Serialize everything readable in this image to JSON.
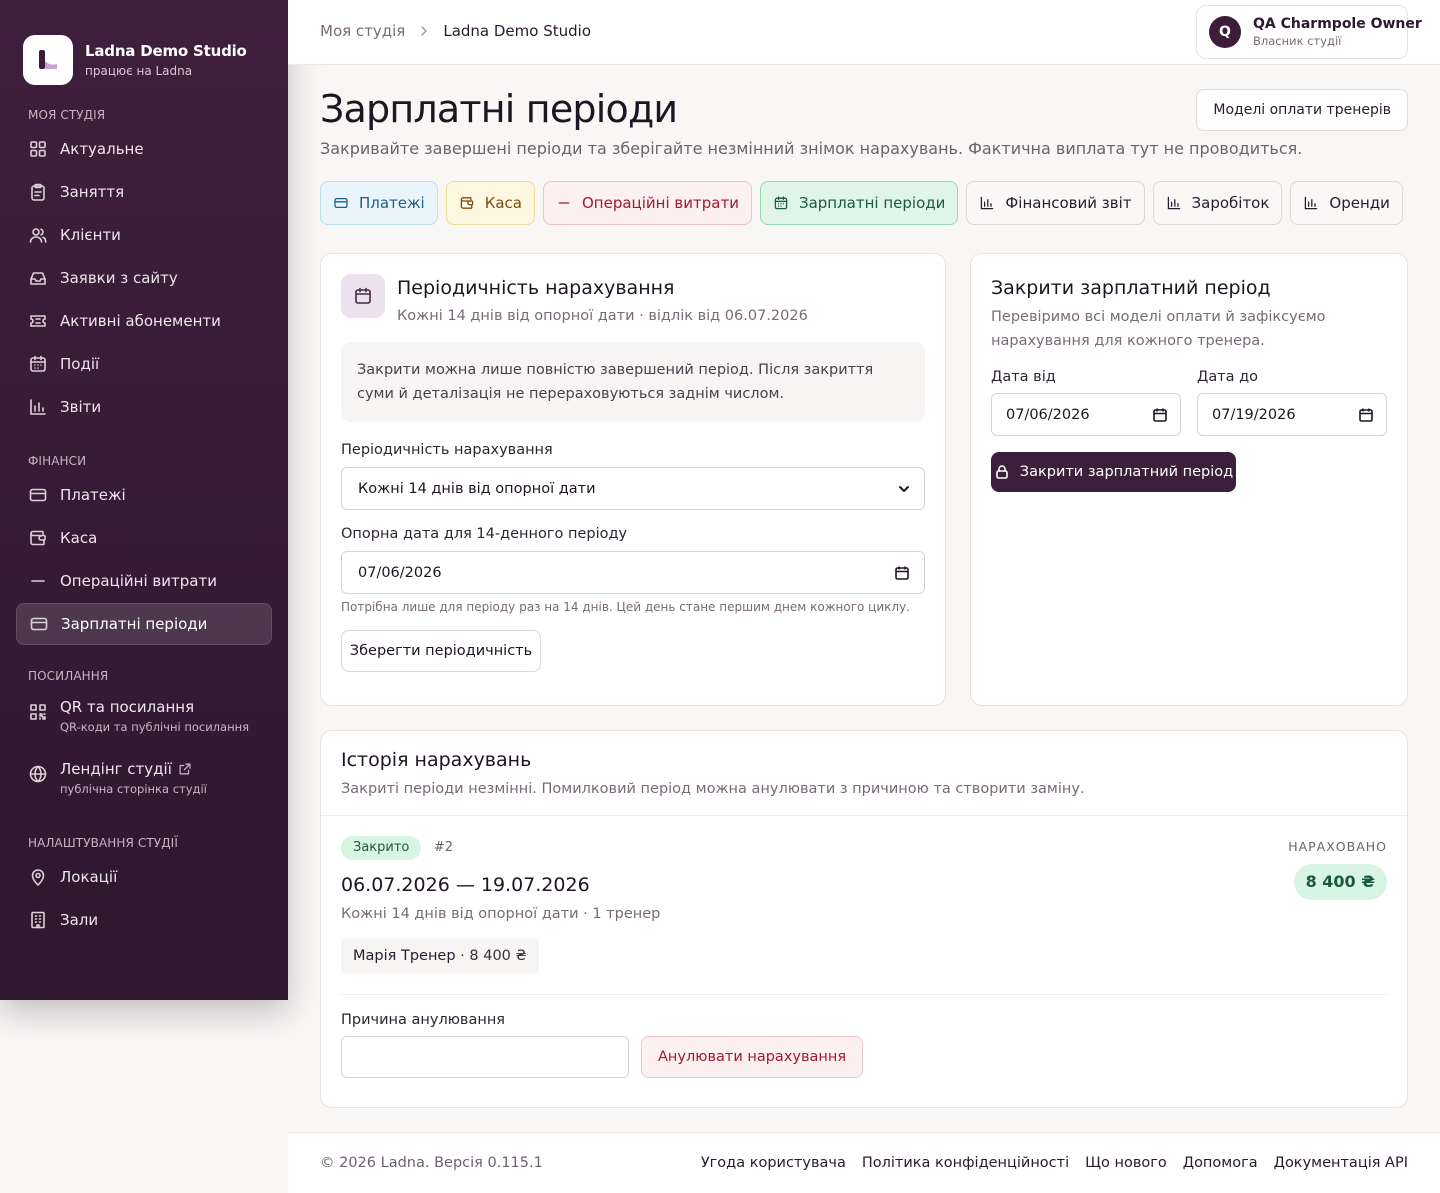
{
  "brand": {
    "name": "Ladna Demo Studio",
    "sub": "працює на Ladna"
  },
  "sidebar": {
    "sections": [
      {
        "label": "МОЯ СТУДІЯ",
        "items": [
          {
            "label": "Актуальне",
            "icon": "dashboard-icon"
          },
          {
            "label": "Заняття",
            "icon": "clipboard-icon"
          },
          {
            "label": "Клієнти",
            "icon": "users-icon"
          },
          {
            "label": "Заявки з сайту",
            "icon": "inbox-icon"
          },
          {
            "label": "Активні абонементи",
            "icon": "ticket-icon"
          },
          {
            "label": "Події",
            "icon": "calendar-icon"
          },
          {
            "label": "Звіти",
            "icon": "bar-chart-icon"
          }
        ]
      },
      {
        "label": "ФІНАНСИ",
        "items": [
          {
            "label": "Платежі",
            "icon": "card-icon"
          },
          {
            "label": "Каса",
            "icon": "wallet-icon"
          },
          {
            "label": "Операційні витрати",
            "icon": "minus-icon"
          },
          {
            "label": "Зарплатні періоди",
            "icon": "card-icon",
            "active": true
          }
        ]
      },
      {
        "label": "ПОСИЛАННЯ",
        "items": [
          {
            "label": "QR та посилання",
            "sub": "QR-коди та публічні посилання",
            "icon": "qr-icon"
          },
          {
            "label": "Лендінг студії",
            "sub": "публічна сторінка студії",
            "icon": "globe-icon",
            "external": true
          }
        ]
      },
      {
        "label": "НАЛАШТУВАННЯ СТУДІЇ",
        "items": [
          {
            "label": "Локації",
            "icon": "map-pin-icon"
          },
          {
            "label": "Зали",
            "icon": "building-icon"
          }
        ]
      }
    ]
  },
  "header": {
    "breadcrumb": [
      "Моя студія",
      "Ladna Demo Studio"
    ],
    "user": {
      "initial": "Q",
      "name": "QA Charmpole Owner",
      "role": "Власник студії"
    }
  },
  "page": {
    "title": "Зарплатні періоди",
    "subtitle": "Закривайте завершені періоди та зберігайте незмінний знімок нарахувань. Фактична виплата тут не проводиться.",
    "models_button": "Моделі оплати тренерів",
    "tabs": [
      {
        "label": "Платежі",
        "icon": "card-icon",
        "style": "blue"
      },
      {
        "label": "Каса",
        "icon": "wallet-icon",
        "style": "yellow"
      },
      {
        "label": "Операційні витрати",
        "icon": "minus-icon",
        "style": "red"
      },
      {
        "label": "Зарплатні періоди",
        "icon": "calendar-icon",
        "style": "green"
      },
      {
        "label": "Фінансовий звіт",
        "icon": "bar-chart-icon",
        "style": "plain"
      },
      {
        "label": "Заробіток",
        "icon": "bar-chart-icon",
        "style": "plain"
      },
      {
        "label": "Оренди",
        "icon": "bar-chart-icon",
        "style": "plain"
      }
    ]
  },
  "periodicity": {
    "title": "Періодичність нарахування",
    "subtitle": "Кожні 14 днів від опорної дати · відлік від 06.07.2026",
    "note": "Закрити можна лише повністю завершений період. Після закриття суми й деталізація не перераховуються заднім числом.",
    "select_label": "Періодичність нарахування",
    "select_value": "Кожні 14 днів від опорної дати",
    "date_label": "Опорна дата для 14-денного періоду",
    "date_value": "07/06/2026",
    "hint": "Потрібна лише для періоду раз на 14 днів. Цей день стане першим днем кожного циклу.",
    "save_button": "Зберегти періодичність"
  },
  "close_period": {
    "title": "Закрити зарплатний період",
    "subtitle": "Перевіримо всі моделі оплати й зафіксуємо нарахування для кожного тренера.",
    "from_label": "Дата від",
    "from_value": "07/06/2026",
    "to_label": "Дата до",
    "to_value": "07/19/2026",
    "button": "Закрити зарплатний період"
  },
  "history": {
    "title": "Історія нарахувань",
    "subtitle": "Закриті періоди незмінні. Помилковий період можна анулювати з причиною та створити заміну.",
    "entry": {
      "status": "Закрито",
      "number": "#2",
      "period": "06.07.2026 — 19.07.2026",
      "meta": "Кожні 14 днів від опорної дати · 1 тренер",
      "trainer_name": "Марія Тренер",
      "trainer_amount": " · 8 400 ₴",
      "accrued_label": "НАРАХОВАНО",
      "accrued_value": "8 400 ₴",
      "cancel_label": "Причина анулювання",
      "cancel_value": "",
      "cancel_button": "Анулювати нарахування"
    }
  },
  "footer": {
    "copyright": "© 2026 Ladna. Версія 0.115.1",
    "links": [
      "Угода користувача",
      "Політика конфіденційності",
      "Що нового",
      "Допомога",
      "Документація API"
    ]
  }
}
